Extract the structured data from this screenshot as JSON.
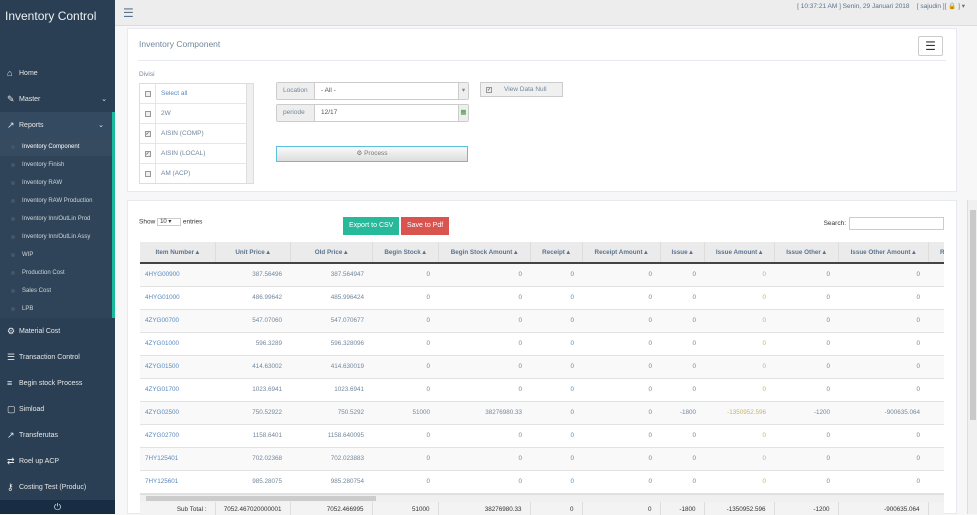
{
  "app": {
    "title": "Inventory Control"
  },
  "topbar": {
    "datetime": "[ 10:37:21 AM ] Senin, 29 Januari 2018",
    "user": "[ sajudin ][ 🔒 ] ▾"
  },
  "sidebar": {
    "items": [
      {
        "label": "Home",
        "icon": "home-icon",
        "glyph": "⌂"
      },
      {
        "label": "Master",
        "icon": "edit-icon",
        "glyph": "✎",
        "chevron": true
      },
      {
        "label": "Reports",
        "icon": "chart-icon",
        "glyph": "↗",
        "chevron": true,
        "active": true
      }
    ],
    "subitems": [
      "Inventory Component",
      "Inventory Finish",
      "Inventory RAW",
      "Inventory RAW Production",
      "Inventory Inn/OutLin Prod",
      "Inventory Inn/OutLin Assy",
      "WIP",
      "Production Cost",
      "Sales Cost",
      "LPB"
    ],
    "items2": [
      {
        "label": "Material Cost",
        "icon": "cogs-icon",
        "glyph": "⚙"
      },
      {
        "label": "Transaction Control",
        "icon": "sliders-icon",
        "glyph": "☰"
      },
      {
        "label": "Begin stock Process",
        "icon": "list-icon",
        "glyph": "≡"
      },
      {
        "label": "Simload",
        "icon": "upload-icon",
        "glyph": "▢"
      },
      {
        "label": "Transferutas",
        "icon": "external-icon",
        "glyph": "↗"
      },
      {
        "label": "Roel up ACP",
        "icon": "exchange-icon",
        "glyph": "⇄"
      },
      {
        "label": "Costing Test (Produc)",
        "icon": "key-icon",
        "glyph": "⚷"
      }
    ]
  },
  "panel1": {
    "title": "Inventory Component",
    "divisi_label": "Divisi",
    "divisi": [
      {
        "label": "Select all",
        "checked": false
      },
      {
        "label": "2W",
        "checked": false
      },
      {
        "label": "AISIN (COMP)",
        "checked": true
      },
      {
        "label": "AISIN (LOCAL)",
        "checked": true
      },
      {
        "label": "AM (ACP)",
        "checked": false
      }
    ],
    "location_label": "Location",
    "location_value": "- All -",
    "periode_label": "periode",
    "periode_value": "12/17",
    "view_null_label": "View Data Null",
    "view_null_checked": true,
    "process_label": "Process"
  },
  "panel2": {
    "show": "Show",
    "entries_value": "10",
    "entries": "entries",
    "export_csv": "Export to CSV",
    "save_pdf": "Save to Pdf",
    "search_label": "Search:",
    "search_value": "",
    "colors": {
      "csv": "#26b99a",
      "pdf": "#d9534f"
    },
    "columns": [
      "Item Number ▴",
      "Unit Price ▴",
      "Old Price ▴",
      "Begin Stock ▴",
      "Begin Stock Amount ▴",
      "Receipt ▴",
      "Receipt Amount ▴",
      "Issue ▴",
      "Issue Amount ▴",
      "Issue Other ▴",
      "Issue Other Amount ▴",
      "Re"
    ],
    "rows": [
      [
        "4HYG00900",
        "387.56496",
        "387.564947",
        "0",
        "0",
        "0",
        "0",
        "0",
        "0",
        "0",
        "0"
      ],
      [
        "4HYG01000",
        "486.99642",
        "485.996424",
        "0",
        "0",
        "0",
        "0",
        "0",
        "0",
        "0",
        "0"
      ],
      [
        "4ZYG00700",
        "547.07060",
        "547.070677",
        "0",
        "0",
        "0",
        "0",
        "0",
        "0",
        "0",
        "0"
      ],
      [
        "4ZYG01000",
        "596.3289",
        "596.328096",
        "0",
        "0",
        "0",
        "0",
        "0",
        "0",
        "0",
        "0"
      ],
      [
        "4ZYG01500",
        "414.63002",
        "414.630019",
        "0",
        "0",
        "0",
        "0",
        "0",
        "0",
        "0",
        "0"
      ],
      [
        "4ZYG01700",
        "1023.6941",
        "1023.6941",
        "0",
        "0",
        "0",
        "0",
        "0",
        "0",
        "0",
        "0"
      ],
      [
        "4ZYG02500",
        "750.52922",
        "750.5292",
        "51000",
        "38276980.33",
        "0",
        "0",
        "-1800",
        "-1350952.596",
        "-1200",
        "-900635.064"
      ],
      [
        "4ZYG02700",
        "1158.6401",
        "1158.640095",
        "0",
        "0",
        "0",
        "0",
        "0",
        "0",
        "0",
        "0"
      ],
      [
        "7HY125401",
        "702.02368",
        "702.023883",
        "0",
        "0",
        "0",
        "0",
        "0",
        "0",
        "0",
        "0"
      ],
      [
        "7HY125601",
        "985.28075",
        "985.280754",
        "0",
        "0",
        "0",
        "0",
        "0",
        "0",
        "0",
        "0"
      ]
    ],
    "footer": [
      "Sub Total :",
      "7052.467020000001",
      "7052.466995",
      "51000",
      "38276980.33",
      "0",
      "0",
      "-1800",
      "-1350952.596",
      "-1200",
      "-900635.064",
      ""
    ]
  }
}
